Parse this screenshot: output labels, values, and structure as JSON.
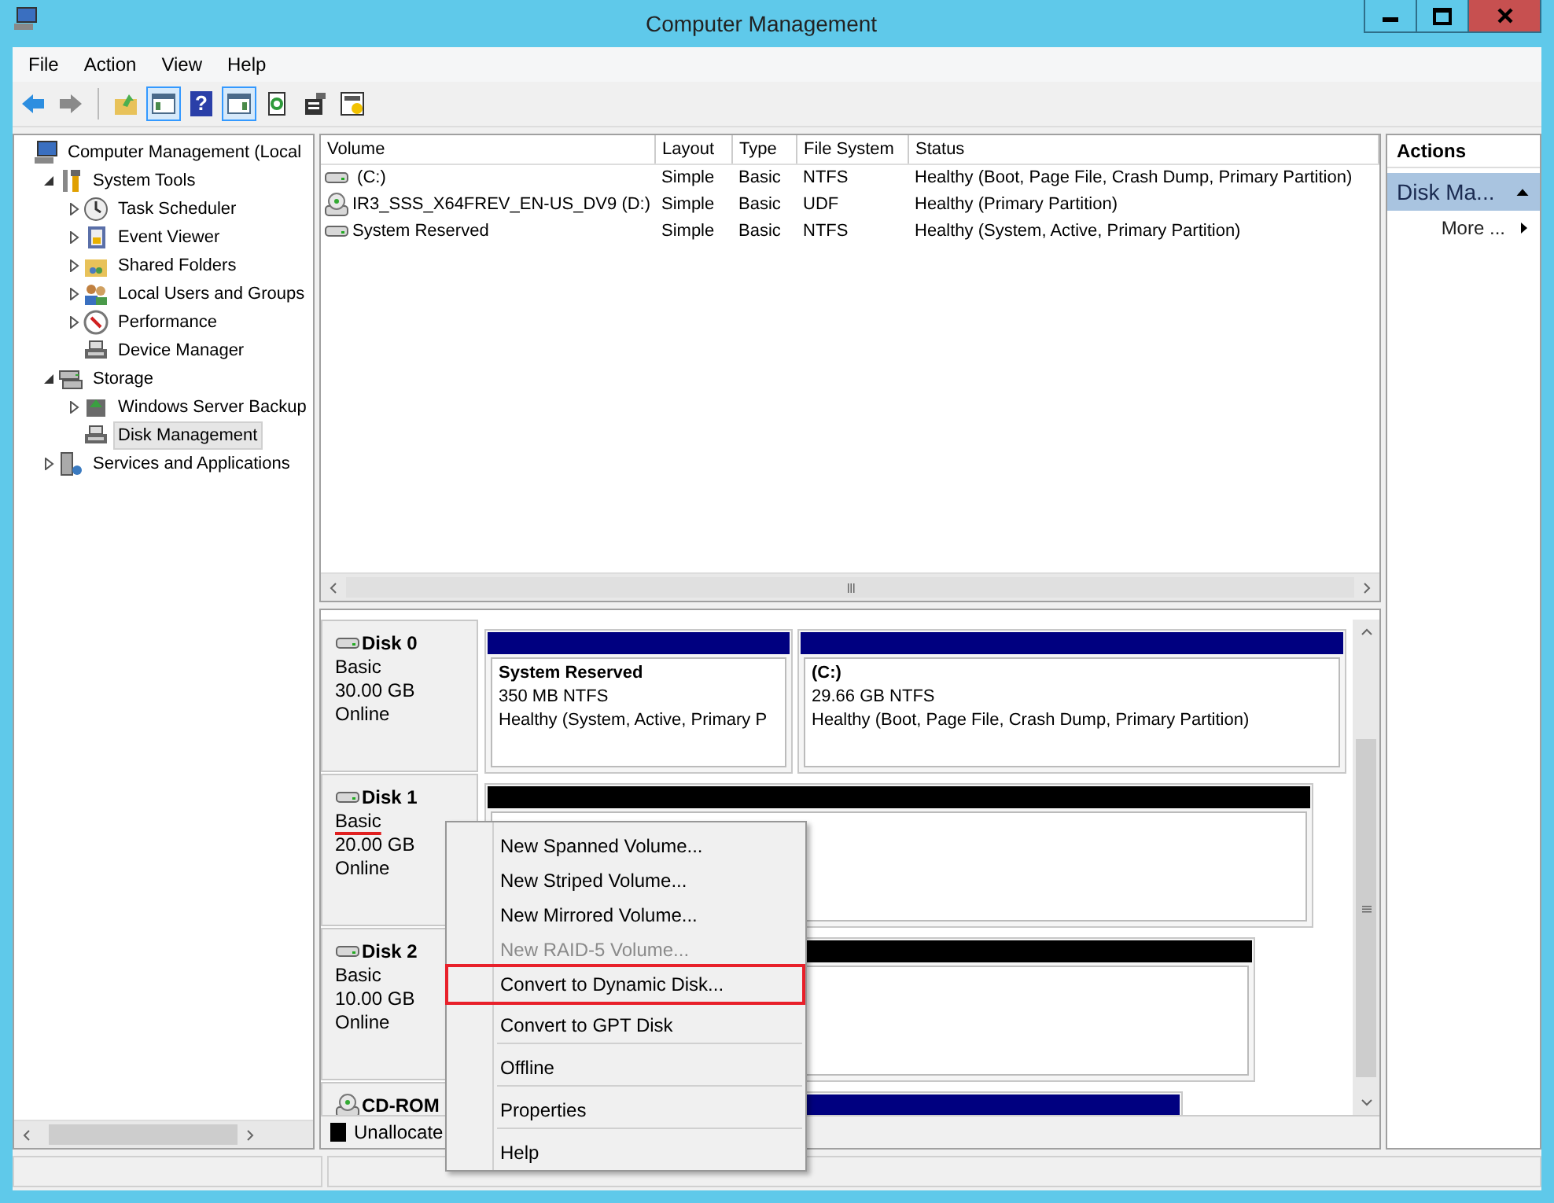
{
  "window": {
    "title": "Computer Management"
  },
  "menu": [
    "File",
    "Action",
    "View",
    "Help"
  ],
  "toolbar": [
    {
      "pressed": false
    },
    {
      "pressed": false
    },
    {
      "pressed": false
    },
    {
      "pressed": true
    },
    {
      "pressed": false,
      "glyph": "?"
    },
    {
      "pressed": true
    },
    {
      "pressed": false
    },
    {
      "pressed": false
    },
    {
      "pressed": false
    }
  ],
  "tree": [
    {
      "label": "Computer Management (Local",
      "selected": false,
      "children": [
        {
          "label": "System Tools",
          "expanded": true,
          "selected": false,
          "children": [
            {
              "label": "Task Scheduler",
              "expanded": false,
              "selected": false
            },
            {
              "label": "Event Viewer",
              "expanded": false,
              "selected": false
            },
            {
              "label": "Shared Folders",
              "expanded": false,
              "selected": false
            },
            {
              "label": "Local Users and Groups",
              "expanded": false,
              "selected": false
            },
            {
              "label": "Performance",
              "expanded": false,
              "selected": false
            },
            {
              "label": "Device Manager",
              "selected": false
            }
          ]
        },
        {
          "label": "Storage",
          "expanded": true,
          "selected": false,
          "children": [
            {
              "label": "Windows Server Backup",
              "expanded": false,
              "selected": false
            },
            {
              "label": "Disk Management",
              "selected": true
            }
          ]
        },
        {
          "label": "Services and Applications",
          "expanded": false,
          "selected": false
        }
      ]
    }
  ],
  "volumes": {
    "columns": [
      "Volume",
      "Layout",
      "Type",
      "File System",
      "Status"
    ],
    "rows": [
      {
        "cells": [
          " (C:)",
          "Simple",
          "Basic",
          "NTFS",
          "Healthy (Boot, Page File, Crash Dump, Primary Partition)"
        ]
      },
      {
        "cells": [
          "IR3_SSS_X64FREV_EN-US_DV9 (D:)",
          "Simple",
          "Basic",
          "UDF",
          "Healthy (Primary Partition)"
        ]
      },
      {
        "cells": [
          "System Reserved",
          "Simple",
          "Basic",
          "NTFS",
          "Healthy (System, Active, Primary Partition)"
        ]
      }
    ]
  },
  "disks": [
    {
      "name": "Disk 0",
      "type": "Basic",
      "type_underlined": false,
      "size": "30.00 GB",
      "state": "Online",
      "partitions": [
        {
          "color": "#000080",
          "title": "System Reserved",
          "detail": "350 MB NTFS",
          "status": "Healthy (System, Active, Primary P"
        },
        {
          "color": "#000080",
          "title": " (C:)",
          "detail": "29.66 GB NTFS",
          "status": "Healthy (Boot, Page File, Crash Dump, Primary Partition)"
        }
      ]
    },
    {
      "name": "Disk 1",
      "type": "Basic",
      "type_underlined": true,
      "size": "20.00 GB",
      "state": "Online",
      "partitions": [
        {
          "color": "#000000"
        }
      ]
    },
    {
      "name": "Disk 2",
      "type": "Basic",
      "type_underlined": false,
      "size": "10.00 GB",
      "state": "Online",
      "partitions": [
        {
          "color": "#000000"
        }
      ]
    },
    {
      "name": "CD-ROM",
      "partitions": [
        {
          "color": "#000080"
        }
      ]
    }
  ],
  "legend": [
    {
      "color": "#000000",
      "label": "Unallocate"
    }
  ],
  "actions": {
    "title": "Actions",
    "section": "Disk Ma...",
    "items": [
      "More ..."
    ]
  },
  "context_menu": [
    {
      "kind": "item",
      "label": "New Spanned Volume...",
      "disabled": false,
      "annotated": false
    },
    {
      "kind": "item",
      "label": "New Striped Volume...",
      "disabled": false,
      "annotated": false
    },
    {
      "kind": "item",
      "label": "New Mirrored Volume...",
      "disabled": false,
      "annotated": false
    },
    {
      "kind": "item",
      "label": "New RAID-5 Volume...",
      "disabled": true,
      "annotated": false
    },
    {
      "kind": "item",
      "label": "Convert to Dynamic Disk...",
      "disabled": false,
      "annotated": true
    },
    {
      "kind": "item",
      "label": "Convert to GPT Disk",
      "disabled": false,
      "annotated": false
    },
    {
      "kind": "separator"
    },
    {
      "kind": "item",
      "label": "Offline",
      "disabled": false,
      "annotated": false
    },
    {
      "kind": "separator"
    },
    {
      "kind": "item",
      "label": "Properties",
      "disabled": false,
      "annotated": false
    },
    {
      "kind": "separator"
    },
    {
      "kind": "item",
      "label": "Help",
      "disabled": false,
      "annotated": false
    }
  ]
}
